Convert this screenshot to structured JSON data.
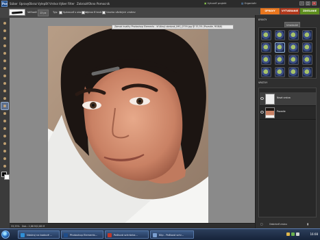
{
  "menubar": {
    "app_logo_text": "Pse",
    "items": [
      "Súbor",
      "Úpravy",
      "Obraz",
      "Vylepšiť",
      "Vrstva",
      "Výber",
      "Filter",
      "Zobraziť",
      "Okno",
      "Pomocník"
    ],
    "create_label": "Vytvoriť projekt",
    "organizer_label": "Organizér"
  },
  "options": {
    "size_label": "Veľkosť:",
    "size_value": "13 px",
    "type_label": "Typ:",
    "type_option1": "Spárovať s obsahom",
    "type_option2": "Vytvoriť textúru",
    "sample_label": "Vzorka všetkých vrstiev"
  },
  "tabs": {
    "edit": "ÚPRAVY",
    "create": "VYTVÁRANIE",
    "share": "ZDIEĽANIE"
  },
  "document": {
    "title": "Zámok kvality Photoshop Elements - kľúčový obrázok_IMG_0759.jpg @ 33,3% (Pozadie, RGB/8)"
  },
  "status": {
    "zoom": "33,33%",
    "doc_info": "Dok.: 2,88 M/2,88 M"
  },
  "panels": {
    "effects_title": "EFEKTY",
    "effects_filter": "Umelecké",
    "layers_title": "VRSTVY",
    "layers_normal": "Normálne",
    "layers_opacity": "Krytie: 100%",
    "layers": [
      "Nová vrstva",
      "Pozadie"
    ],
    "layers_footer": "Odstrániť vrstvu"
  },
  "taskbar": {
    "tasks": [
      "Nástroj na bodové ...",
      "Photoshop Elements...",
      "Poštová schránka...",
      "Klip - Poštová schr..."
    ],
    "clock": "16:08"
  },
  "colors": {
    "edit_tab": "#e8761e",
    "create_tab": "#b23a1d",
    "share_tab": "#5f8e1f"
  }
}
